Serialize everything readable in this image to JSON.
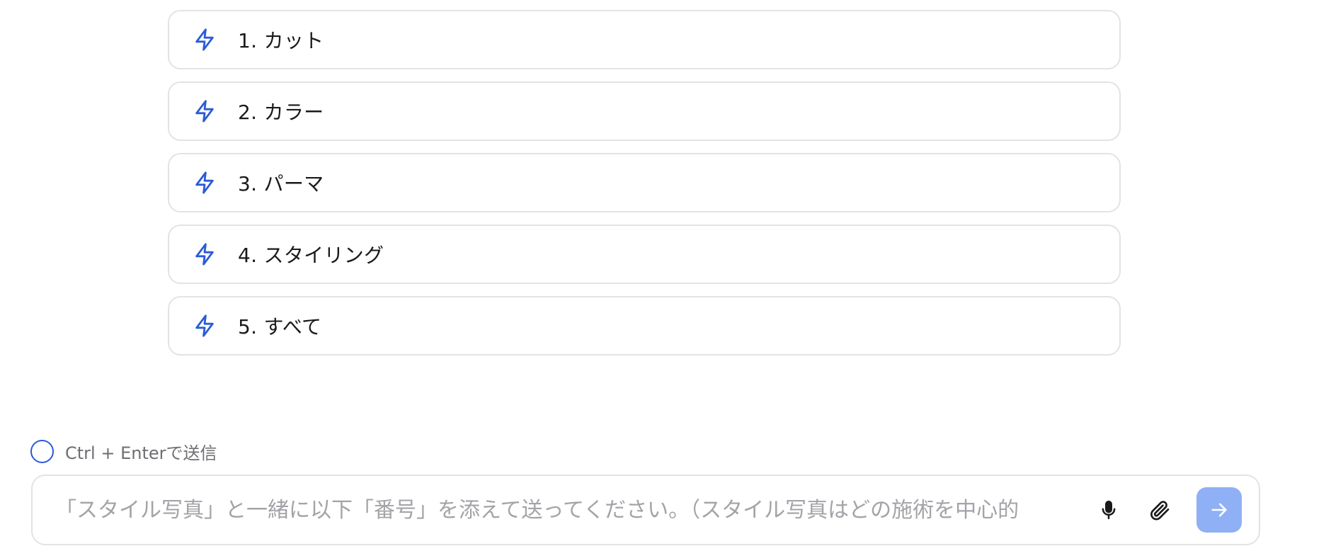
{
  "options": [
    {
      "label": "1. カット",
      "icon": "bolt-icon"
    },
    {
      "label": "2. カラー",
      "icon": "bolt-icon"
    },
    {
      "label": "3. パーマ",
      "icon": "bolt-icon"
    },
    {
      "label": "4. スタイリング",
      "icon": "bolt-icon"
    },
    {
      "label": "5. すべて",
      "icon": "bolt-icon"
    }
  ],
  "send_toggle": {
    "label": "Ctrl + Enterで送信",
    "checked": false
  },
  "composer": {
    "placeholder": "「スタイル写真」と一緒に以下「番号」を添えて送ってください。（スタイル写真はどの施術を中心的",
    "value": "",
    "mic_icon": "microphone-icon",
    "attach_icon": "paperclip-icon",
    "send_icon": "arrow-right-icon"
  },
  "colors": {
    "accent": "#2b5ad8",
    "icon_blue": "#2a5bd7",
    "send_button": "#8fb0f5",
    "border": "#e3e3e6",
    "placeholder": "#a3a3a8"
  }
}
